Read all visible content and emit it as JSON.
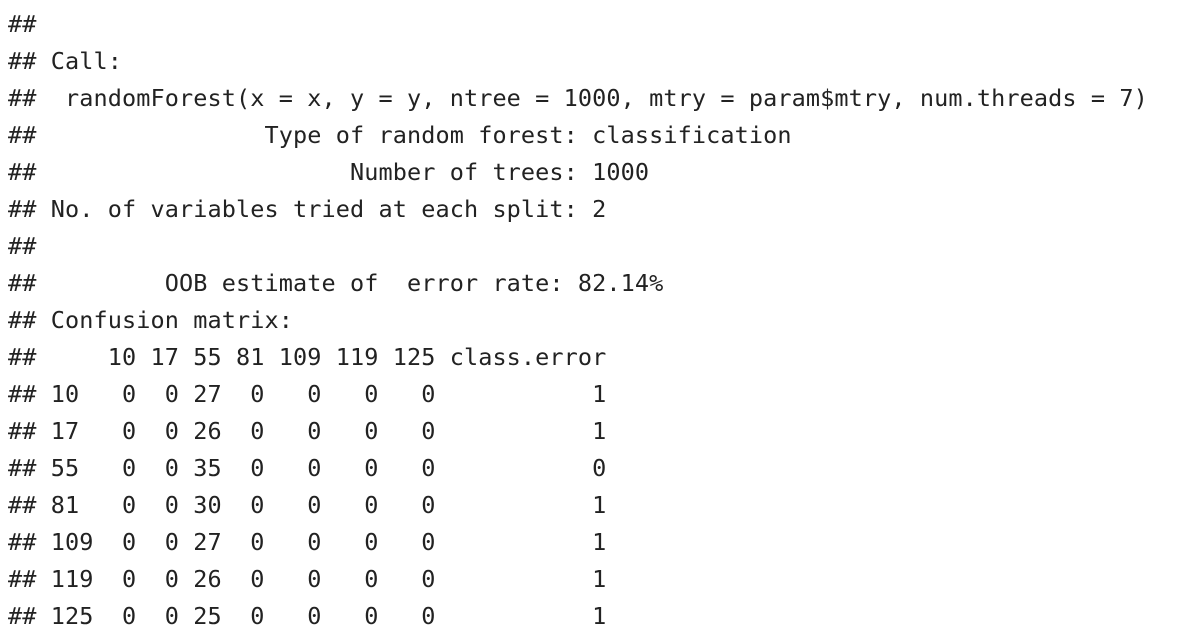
{
  "output": {
    "lines": [
      "##",
      "## Call:",
      "##  randomForest(x = x, y = y, ntree = 1000, mtry = param$mtry, num.threads = 7)",
      "##                Type of random forest: classification",
      "##                      Number of trees: 1000",
      "## No. of variables tried at each split: 2",
      "##",
      "##         OOB estimate of  error rate: 82.14%",
      "## Confusion matrix:",
      "##     10 17 55 81 109 119 125 class.error",
      "## 10   0  0 27  0   0   0   0           1",
      "## 17   0  0 26  0   0   0   0           1",
      "## 55   0  0 35  0   0   0   0           0",
      "## 81   0  0 30  0   0   0   0           1",
      "## 109  0  0 27  0   0   0   0           1",
      "## 119  0  0 26  0   0   0   0           1",
      "## 125  0  0 25  0   0   0   0           1"
    ]
  }
}
